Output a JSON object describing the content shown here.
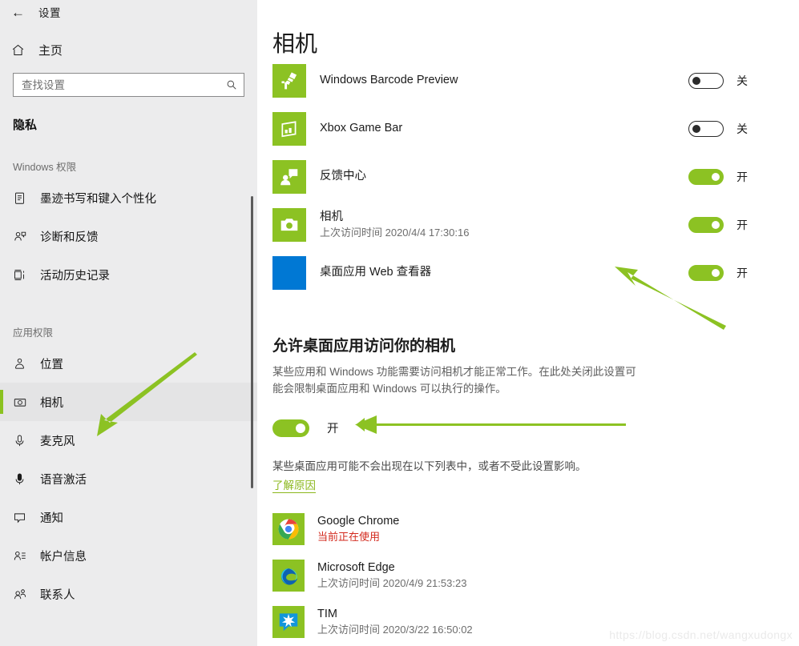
{
  "window": {
    "back_icon": "back-arrow-icon",
    "title": "设置"
  },
  "sidebar": {
    "home": {
      "label": "主页",
      "icon": "home-icon"
    },
    "search": {
      "placeholder": "查找设置",
      "value": "",
      "icon": "search-icon"
    },
    "section_title": "隐私",
    "groups": [
      {
        "label": "Windows 权限",
        "items": [
          {
            "label": "墨迹书写和键入个性化",
            "icon": "clipboard-pen-icon",
            "selected": false
          },
          {
            "label": "诊断和反馈",
            "icon": "person-feedback-icon",
            "selected": false
          },
          {
            "label": "活动历史记录",
            "icon": "activity-history-icon",
            "selected": false
          }
        ]
      },
      {
        "label": "应用权限",
        "items": [
          {
            "label": "位置",
            "icon": "location-icon",
            "selected": false
          },
          {
            "label": "相机",
            "icon": "camera-icon",
            "selected": true
          },
          {
            "label": "麦克风",
            "icon": "microphone-icon",
            "selected": false
          },
          {
            "label": "语音激活",
            "icon": "voice-activation-icon",
            "selected": false
          },
          {
            "label": "通知",
            "icon": "notification-icon",
            "selected": false
          },
          {
            "label": "帐户信息",
            "icon": "account-info-icon",
            "selected": false
          },
          {
            "label": "联系人",
            "icon": "contacts-icon",
            "selected": false
          }
        ]
      }
    ]
  },
  "main": {
    "page_title": "相机",
    "store_apps": [
      {
        "name": "Windows Barcode Preview",
        "sub": "",
        "icon": "barcode-scanner-icon",
        "tile": "green",
        "toggle_state": "off",
        "toggle_label": "关"
      },
      {
        "name": "Xbox Game Bar",
        "sub": "",
        "icon": "xbox-game-bar-icon",
        "tile": "green",
        "toggle_state": "off",
        "toggle_label": "关"
      },
      {
        "name": "反馈中心",
        "sub": "",
        "icon": "feedback-hub-icon",
        "tile": "green",
        "toggle_state": "on",
        "toggle_label": "开"
      },
      {
        "name": "相机",
        "sub": "上次访问时间 2020/4/4 17:30:16",
        "icon": "camera-app-icon",
        "tile": "green",
        "toggle_state": "on",
        "toggle_label": "开"
      },
      {
        "name": "桌面应用 Web 查看器",
        "sub": "",
        "icon": "desktop-web-viewer-icon",
        "tile": "blue",
        "toggle_state": "on",
        "toggle_label": "开"
      }
    ],
    "desktop_section": {
      "heading": "允许桌面应用访问你的相机",
      "description": "某些应用和 Windows 功能需要访问相机才能正常工作。在此处关闭此设置可能会限制桌面应用和 Windows 可以执行的操作。",
      "master_toggle_state": "on",
      "master_toggle_label": "开",
      "note": "某些桌面应用可能不会出现在以下列表中，或者不受此设置影响。",
      "note_link": "了解原因"
    },
    "desktop_apps": [
      {
        "name": "Google Chrome",
        "sub": "当前正在使用",
        "sub_style": "in-use",
        "icon": "chrome-icon",
        "tile": "green"
      },
      {
        "name": "Microsoft Edge",
        "sub": "上次访问时间 2020/4/9 21:53:23",
        "sub_style": "normal",
        "icon": "edge-icon",
        "tile": "green"
      },
      {
        "name": "TIM",
        "sub": "上次访问时间 2020/3/22 16:50:02",
        "sub_style": "normal",
        "icon": "tim-icon",
        "tile": "green"
      }
    ]
  },
  "annotations": {
    "arrow_color": "#8cc223",
    "arrows": [
      {
        "name": "arrow-to-sidebar-camera"
      },
      {
        "name": "arrow-to-webviewer-toggle"
      },
      {
        "name": "arrow-to-master-toggle"
      }
    ]
  },
  "watermark": {
    "text": "https://blog.csdn.net/wangxudongx"
  },
  "colors": {
    "accent_green": "#8cc223",
    "tile_blue": "#0078d4",
    "in_use_red": "#d32a1e",
    "sidebar_bg": "#ececed"
  }
}
